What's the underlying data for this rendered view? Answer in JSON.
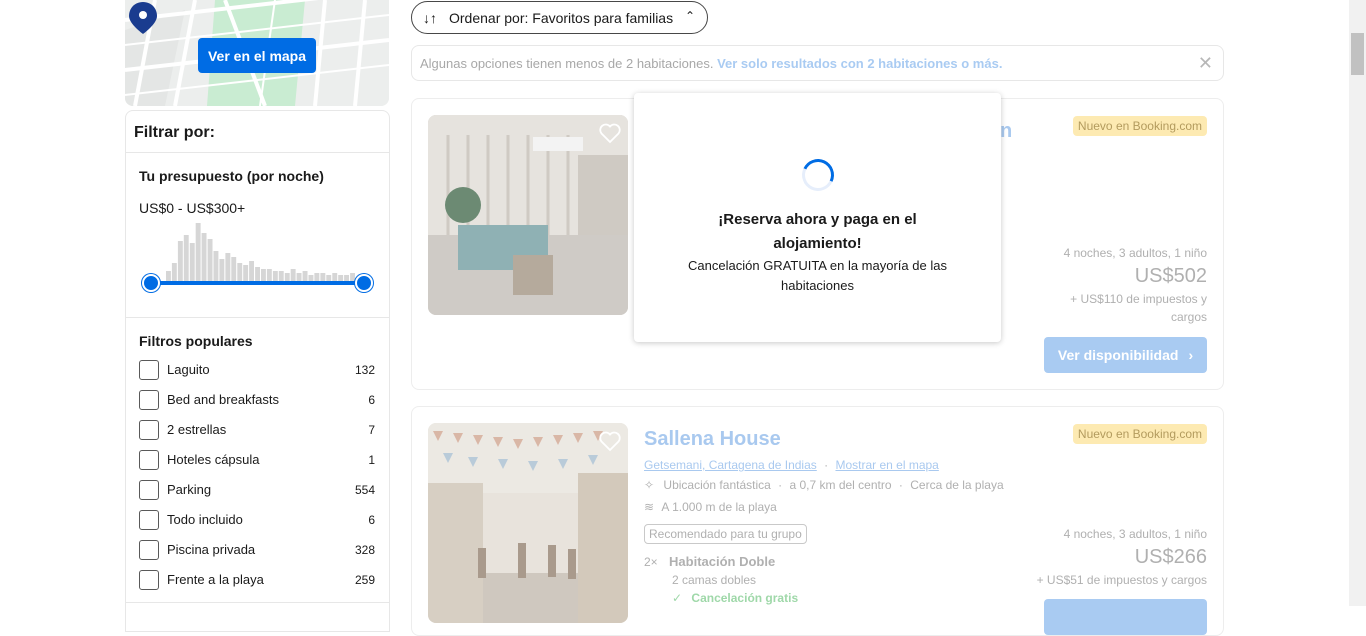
{
  "map": {
    "button_label": "Ver en el mapa",
    "icon": "map-pin-icon"
  },
  "filters": {
    "title": "Filtrar por:",
    "budget": {
      "title": "Tu presupuesto (por noche)",
      "range": "US$0 - US$300+"
    },
    "popular": {
      "title": "Filtros populares",
      "items": [
        {
          "label": "Laguito",
          "count": "132"
        },
        {
          "label": "Bed and breakfasts",
          "count": "6"
        },
        {
          "label": "2 estrellas",
          "count": "7"
        },
        {
          "label": "Hoteles cápsula",
          "count": "1"
        },
        {
          "label": "Parking",
          "count": "554"
        },
        {
          "label": "Todo incluido",
          "count": "6"
        },
        {
          "label": "Piscina privada",
          "count": "328"
        },
        {
          "label": "Frente a la playa",
          "count": "259"
        }
      ]
    }
  },
  "sort": {
    "label": "Ordenar por: Favoritos para familias"
  },
  "banner": {
    "text": "Algunas opciones tienen menos de 2 habitaciones.",
    "link": "Ver solo resultados con 2 habitaciones o más."
  },
  "cards": [
    {
      "name_partial": "n",
      "badge": "Nuevo en Booking.com",
      "stay": "4 noches, 3 adultos, 1 niño",
      "price": "US$502",
      "taxes_line1": "+ US$110 de impuestos y",
      "taxes_line2": "cargos",
      "button": "Ver disponibilidad"
    },
    {
      "name": "Sallena House",
      "badge": "Nuevo en Booking.com",
      "location": "Getsemani, Cartagena de Indias",
      "map_link": "Mostrar en el mapa",
      "location_rating": "Ubicación fantástica",
      "distance": "a 0,7 km del centro",
      "beach_near": "Cerca de la playa",
      "beach_dist": "A 1.000 m de la playa",
      "recommended": "Recomendado para tu grupo",
      "room_qty": "2×",
      "room_type": "Habitación Doble",
      "beds": "2 camas dobles",
      "cancel": "Cancelación gratis",
      "stay": "4 noches, 3 adultos, 1 niño",
      "price": "US$266",
      "taxes": "+ US$51 de impuestos y cargos"
    }
  ],
  "modal": {
    "title": "¡Reserva ahora y paga en el alojamiento!",
    "subtitle": "Cancelación GRATUITA en la mayoría de las habitaciones"
  },
  "colors": {
    "primary": "#006ce4",
    "faded_link": "#a9cbf2",
    "badge_bg": "#fdeab2"
  }
}
